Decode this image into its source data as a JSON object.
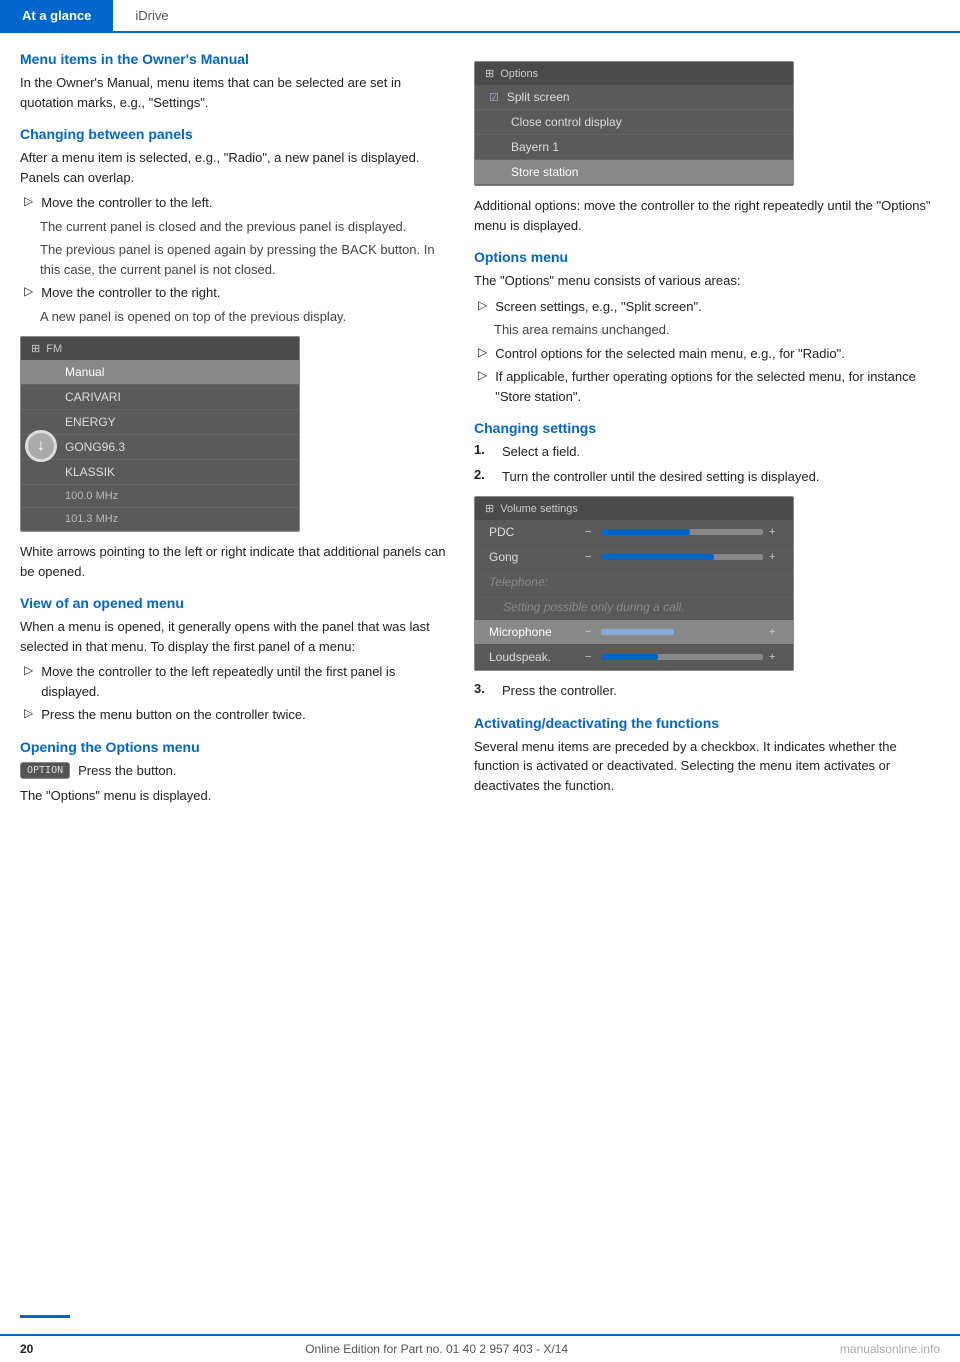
{
  "header": {
    "tab1": "At a glance",
    "tab2": "iDrive"
  },
  "left": {
    "section1_title": "Menu items in the Owner's Manual",
    "section1_body": "In the Owner's Manual, menu items that can be selected are set in quotation marks, e.g., \"Settings\".",
    "section2_title": "Changing between panels",
    "section2_body": "After a menu item is selected, e.g., \"Radio\", a new panel is displayed. Panels can overlap.",
    "bullet1": "Move the controller to the left.",
    "sub1a": "The current panel is closed and the previous panel is displayed.",
    "sub1b": "The previous panel is opened again by pressing the BACK button. In this case, the current panel is not closed.",
    "bullet2": "Move the controller to the right.",
    "sub2a": "A new panel is opened on top of the previous display.",
    "caption1": "White arrows pointing to the left or right indicate that additional panels can be opened.",
    "section3_title": "View of an opened menu",
    "section3_body": "When a menu is opened, it generally opens with the panel that was last selected in that menu. To display the first panel of a menu:",
    "bullet3": "Move the controller to the left repeatedly until the first panel is displayed.",
    "bullet4": "Press the menu button on the controller twice.",
    "section4_title": "Opening the Options menu",
    "option_btn_label": "OPTION",
    "option_press": "Press the button.",
    "option_displayed": "The \"Options\" menu is displayed."
  },
  "fm_screenshot": {
    "header": "FM",
    "items": [
      {
        "label": "Manual",
        "highlighted": true
      },
      {
        "label": "CARIVARI",
        "highlighted": false
      },
      {
        "label": "ENERGY",
        "highlighted": false
      },
      {
        "label": "GONG96.3",
        "highlighted": false
      },
      {
        "label": "KLASSIK",
        "highlighted": false
      },
      {
        "label": "100.0 MHz",
        "highlighted": false,
        "small": true
      },
      {
        "label": "101.3 MHz",
        "highlighted": false,
        "small": true
      }
    ]
  },
  "right": {
    "options_header": "Options",
    "options_items": [
      {
        "label": "Split screen",
        "check": true,
        "highlighted": false
      },
      {
        "label": "Close control display",
        "check": false,
        "highlighted": false
      },
      {
        "label": "Bayern 1",
        "check": false,
        "highlighted": false
      },
      {
        "label": "Store station",
        "check": false,
        "highlighted": true
      }
    ],
    "caption_options": "Additional options: move the controller to the right repeatedly until the \"Options\" menu is displayed.",
    "section_options_title": "Options menu",
    "options_body": "The \"Options\" menu consists of various areas:",
    "opt_bullet1": "Screen settings, e.g., \"Split screen\".",
    "opt_sub1": "This area remains unchanged.",
    "opt_bullet2": "Control options for the selected main menu, e.g., for \"Radio\".",
    "opt_bullet3": "If applicable, further operating options for the selected menu, for instance \"Store station\".",
    "section_settings_title": "Changing settings",
    "settings_num1": "Select a field.",
    "settings_num2": "Turn the controller until the desired setting is displayed.",
    "volume_header": "Volume settings",
    "volume_rows": [
      {
        "label": "PDC",
        "fill": 55,
        "disabled": false
      },
      {
        "label": "Gong",
        "fill": 70,
        "disabled": false
      },
      {
        "label": "Telephone:",
        "fill": 0,
        "disabled": true,
        "note": ""
      },
      {
        "label": "Setting possible only during a call.",
        "fill": 0,
        "disabled": true,
        "note_only": true
      },
      {
        "label": "Microphone",
        "fill": 45,
        "disabled": false,
        "highlighted": true
      },
      {
        "label": "Loudspeak.",
        "fill": 35,
        "disabled": false
      }
    ],
    "settings_num3": "Press the controller.",
    "section_activate_title": "Activating/deactivating the functions",
    "activate_body": "Several menu items are preceded by a checkbox. It indicates whether the function is activated or deactivated. Selecting the menu item activates or deactivates the function."
  },
  "footer": {
    "page": "20",
    "text": "Online Edition for Part no. 01 40 2 957 403 - X/14",
    "watermark": "manualsonline.info"
  }
}
